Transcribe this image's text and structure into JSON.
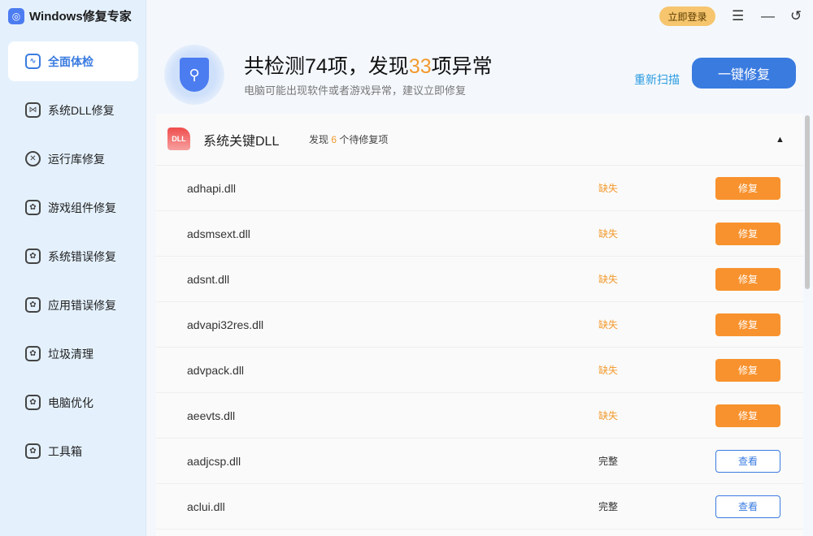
{
  "app": {
    "title": "Windows修复专家",
    "login": "立即登录"
  },
  "sidebar": {
    "items": [
      {
        "label": "全面体检",
        "icon": "monitor-pulse-icon"
      },
      {
        "label": "系统DLL修复",
        "icon": "dll-icon"
      },
      {
        "label": "运行库修复",
        "icon": "x-circle-icon"
      },
      {
        "label": "游戏组件修复",
        "icon": "gear-icon"
      },
      {
        "label": "系统错误修复",
        "icon": "gear-icon"
      },
      {
        "label": "应用错误修复",
        "icon": "gear-icon"
      },
      {
        "label": "垃圾清理",
        "icon": "gear-icon"
      },
      {
        "label": "电脑优化",
        "icon": "gear-icon"
      },
      {
        "label": "工具箱",
        "icon": "gear-icon"
      }
    ]
  },
  "header": {
    "title_pre": "共检测74项，发现",
    "title_count": "33",
    "title_post": "项异常",
    "subtitle": "电脑可能出现软件或者游戏异常，建议立即修复",
    "rescan": "重新扫描",
    "fix_all": "一键修复"
  },
  "panel": {
    "title": "系统关键DLL",
    "count_pre": "发现",
    "count": "6",
    "count_post": "个待修复项",
    "badge": "DLL",
    "rows": [
      {
        "name": "adhapi.dll",
        "status": "缺失",
        "action": "修复"
      },
      {
        "name": "adsmsext.dll",
        "status": "缺失",
        "action": "修复"
      },
      {
        "name": "adsnt.dll",
        "status": "缺失",
        "action": "修复"
      },
      {
        "name": "advapi32res.dll",
        "status": "缺失",
        "action": "修复"
      },
      {
        "name": "advpack.dll",
        "status": "缺失",
        "action": "修复"
      },
      {
        "name": "aeevts.dll",
        "status": "缺失",
        "action": "修复"
      },
      {
        "name": "aadjcsp.dll",
        "status": "完整",
        "action": "查看"
      },
      {
        "name": "aclui.dll",
        "status": "完整",
        "action": "查看"
      }
    ]
  },
  "colors": {
    "accent": "#3a7be0",
    "warn": "#f8922e",
    "missing": "#f39a2e"
  }
}
